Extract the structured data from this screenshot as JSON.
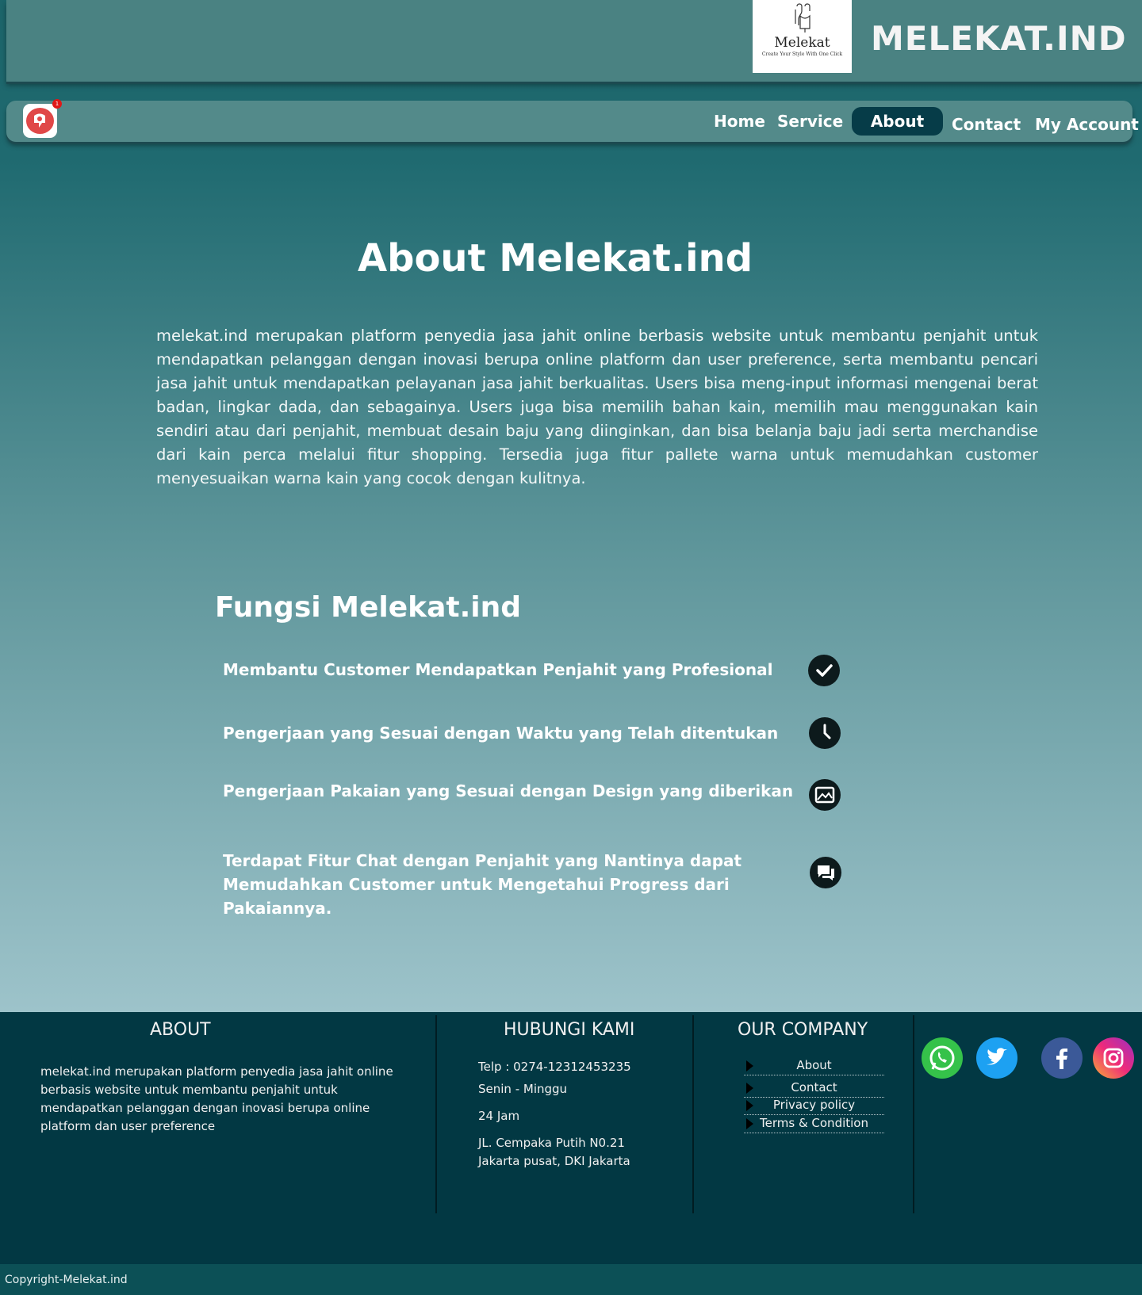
{
  "header": {
    "logo_name": "Melekat",
    "logo_tagline": "Create Your Style With One Click",
    "brand_title": "MELEKAT.IND"
  },
  "nav": {
    "notification_count": "1",
    "items": [
      {
        "label": "Home"
      },
      {
        "label": "Service"
      },
      {
        "label": "About"
      },
      {
        "label": "Contact"
      },
      {
        "label": "My Account"
      }
    ],
    "active": "About"
  },
  "main": {
    "title": "About Melekat.ind",
    "description": "melekat.ind merupakan platform penyedia jasa jahit online berbasis website untuk membantu penjahit untuk mendapatkan pelanggan dengan inovasi berupa online platform dan user preference, serta membantu pencari jasa jahit untuk mendapatkan pelayanan jasa jahit berkualitas. Users bisa meng-input informasi mengenai berat badan, lingkar dada, dan sebagainya. Users juga bisa memilih bahan kain, memilih mau menggunakan kain sendiri atau dari penjahit, membuat desain baju yang diinginkan, dan bisa belanja baju jadi serta merchandise dari kain perca melalui fitur shopping. Tersedia juga fitur pallete warna untuk memudahkan customer menyesuaikan warna kain yang cocok dengan kulitnya.",
    "fungsi_title": "Fungsi Melekat.ind",
    "features": [
      {
        "text": "Membantu Customer Mendapatkan Penjahit yang Profesional",
        "icon": "check-circle-icon"
      },
      {
        "text": "Pengerjaan yang Sesuai dengan Waktu yang Telah ditentukan",
        "icon": "clock-icon"
      },
      {
        "text": "Pengerjaan Pakaian yang Sesuai dengan Design yang diberikan",
        "icon": "image-icon"
      },
      {
        "text": "Terdapat Fitur Chat dengan Penjahit yang Nantinya  dapat Memudahkan Customer untuk Mengetahui Progress dari Pakaiannya.",
        "icon": "chat-icon"
      }
    ]
  },
  "footer": {
    "about": {
      "heading": "ABOUT",
      "text": "melekat.ind merupakan platform penyedia jasa jahit online berbasis website untuk membantu penjahit untuk mendapatkan pelanggan dengan inovasi berupa online platform dan user preference"
    },
    "contact": {
      "heading": "HUBUNGI KAMI",
      "phone": "Telp  :  0274-12312453235",
      "days": "Senin - Minggu",
      "hours": "24 Jam",
      "address_line1": "JL. Cempaka Putih N0.21",
      "address_line2": "Jakarta pusat, DKI Jakarta"
    },
    "company": {
      "heading": "OUR COMPANY",
      "links": [
        "About",
        "Contact",
        "Privacy policy",
        "Terms & Condition"
      ]
    },
    "social": [
      "whatsapp-icon",
      "twitter-icon",
      "facebook-icon",
      "instagram-icon"
    ],
    "copyright": "Copyright-Melekat.ind"
  },
  "colors": {
    "header_bg": "#4a8282",
    "nav_bg": "#538a8a",
    "nav_active": "#063c48",
    "footer_bg": "#023843"
  }
}
